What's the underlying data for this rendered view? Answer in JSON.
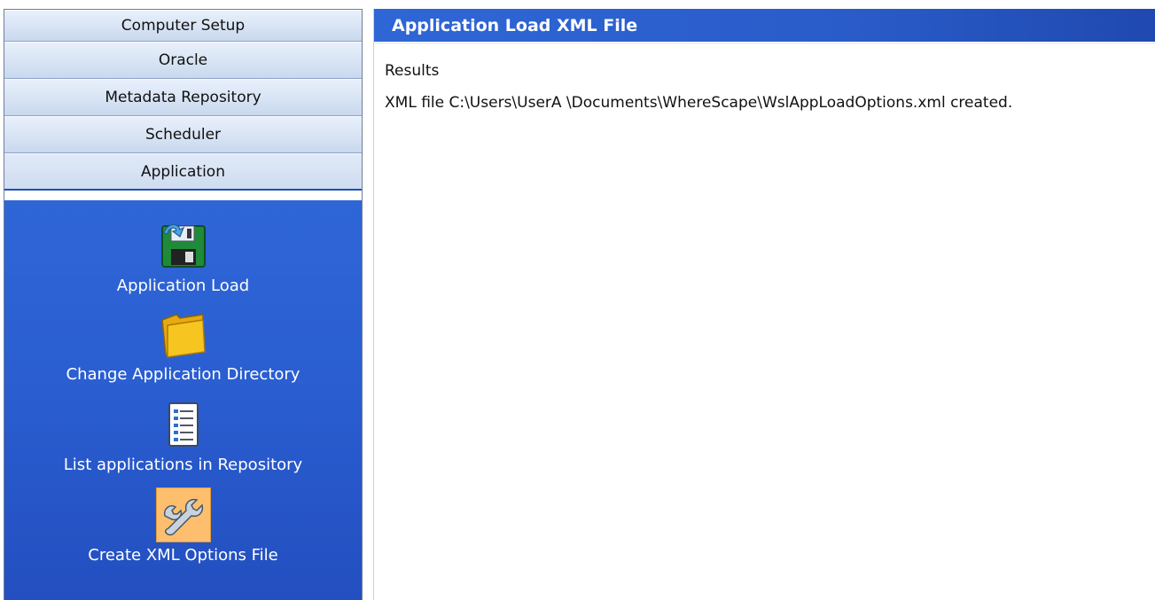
{
  "sidebar": {
    "headers": [
      {
        "label": "Computer Setup"
      },
      {
        "label": "Oracle"
      },
      {
        "label": "Metadata Repository"
      },
      {
        "label": "Scheduler"
      },
      {
        "label": "Application"
      }
    ],
    "tools": [
      {
        "label": "Application Load",
        "icon": "floppy-disk-load-icon"
      },
      {
        "label": "Change Application Directory",
        "icon": "folder-icon"
      },
      {
        "label": "List applications in Repository",
        "icon": "document-list-icon"
      },
      {
        "label": "Create XML Options File",
        "icon": "wrench-icon",
        "selected": true
      }
    ]
  },
  "main": {
    "title": "Application Load XML File",
    "results_heading": "Results",
    "results_line": "XML file C:\\Users\\UserA \\Documents\\WhereScape\\WslAppLoadOptions.xml created."
  },
  "colors": {
    "panel_blue": "#2a5ed1",
    "selected_tool_bg": "#fdbf6e",
    "header_gradient_light": "#e8f0fb"
  }
}
